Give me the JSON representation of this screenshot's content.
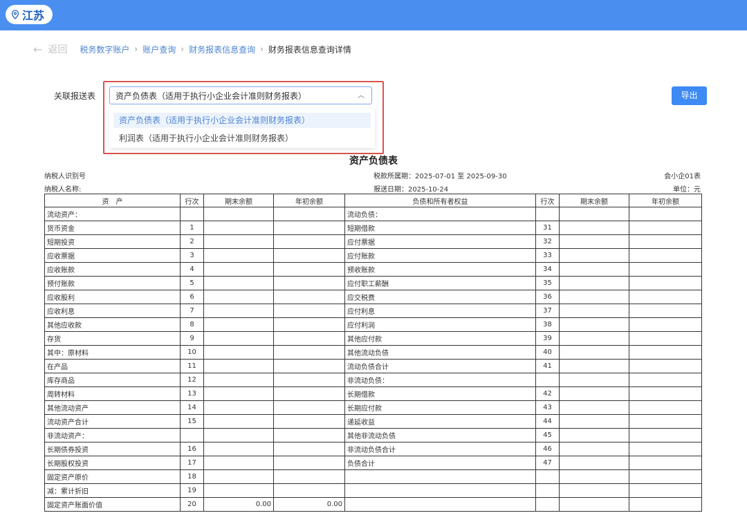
{
  "header": {
    "region": "江苏"
  },
  "breadcrumb": {
    "back": "返回",
    "items": [
      "税务数字账户",
      "账户查询",
      "财务报表信息查询",
      "财务报表信息查询详情"
    ]
  },
  "filter": {
    "label": "关联报送表",
    "selected": "资产负债表（适用于执行小企业会计准则财务报表）",
    "options": [
      "资产负债表（适用于执行小企业会计准则财务报表）",
      "利润表（适用于执行小企业会计准则财务报表）"
    ],
    "export": "导出"
  },
  "sheet": {
    "title": "资产负债表",
    "taxpayer_id_label": "纳税人识别号",
    "taxpayer_name_label": "纳税人名称:",
    "period": "税款所属期：2025-07-01 至 2025-09-30",
    "submit_date": "报送日期：2025-10-24",
    "form_code": "会小企01表",
    "unit": "单位：元"
  },
  "table": {
    "headers": [
      "资　产",
      "行次",
      "期末余额",
      "年初余额",
      "负债和所有者权益",
      "行次",
      "期末余额",
      "年初余额"
    ],
    "rows": [
      [
        "流动资产：",
        "",
        "",
        "",
        "流动负债：",
        "",
        "",
        ""
      ],
      [
        "货币资金",
        "1",
        "",
        "",
        "短期借款",
        "31",
        "",
        ""
      ],
      [
        "短期投资",
        "2",
        "",
        "",
        "应付票据",
        "32",
        "",
        ""
      ],
      [
        "应收票据",
        "3",
        "",
        "",
        "应付账款",
        "33",
        "",
        ""
      ],
      [
        "应收账款",
        "4",
        "",
        "",
        "预收账款",
        "34",
        "",
        ""
      ],
      [
        "预付账款",
        "5",
        "",
        "",
        "应付职工薪酬",
        "35",
        "",
        ""
      ],
      [
        "应收股利",
        "6",
        "",
        "",
        "应交税费",
        "36",
        "",
        ""
      ],
      [
        "应收利息",
        "7",
        "",
        "",
        "应付利息",
        "37",
        "",
        ""
      ],
      [
        "其他应收款",
        "8",
        "",
        "",
        "应付利润",
        "38",
        "",
        ""
      ],
      [
        "存货",
        "9",
        "",
        "",
        "其他应付款",
        "39",
        "",
        ""
      ],
      [
        "其中：原材料",
        "10",
        "",
        "",
        "其他流动负债",
        "40",
        "",
        ""
      ],
      [
        "在产品",
        "11",
        "",
        "",
        "流动负债合计",
        "41",
        "",
        ""
      ],
      [
        "库存商品",
        "12",
        "",
        "",
        "非流动负债：",
        "",
        "",
        ""
      ],
      [
        "周转材料",
        "13",
        "",
        "",
        "长期借款",
        "42",
        "",
        ""
      ],
      [
        "其他流动资产",
        "14",
        "",
        "",
        "长期应付款",
        "43",
        "",
        ""
      ],
      [
        "流动资产合计",
        "15",
        "",
        "",
        "递延收益",
        "44",
        "",
        ""
      ],
      [
        "非流动资产：",
        "",
        "",
        "",
        "其他非流动负债",
        "45",
        "",
        ""
      ],
      [
        "长期债券投资",
        "16",
        "",
        "",
        "非流动负债合计",
        "46",
        "",
        ""
      ],
      [
        "长期股权投资",
        "17",
        "",
        "",
        "负债合计",
        "47",
        "",
        ""
      ],
      [
        "固定资产原价",
        "18",
        "",
        "",
        "",
        "",
        "",
        ""
      ],
      [
        "减：累计折旧",
        "19",
        "",
        "",
        "",
        "",
        "",
        ""
      ],
      [
        "固定资产账面价值",
        "20",
        "0.00",
        "0.00",
        "",
        "",
        "",
        ""
      ]
    ]
  }
}
